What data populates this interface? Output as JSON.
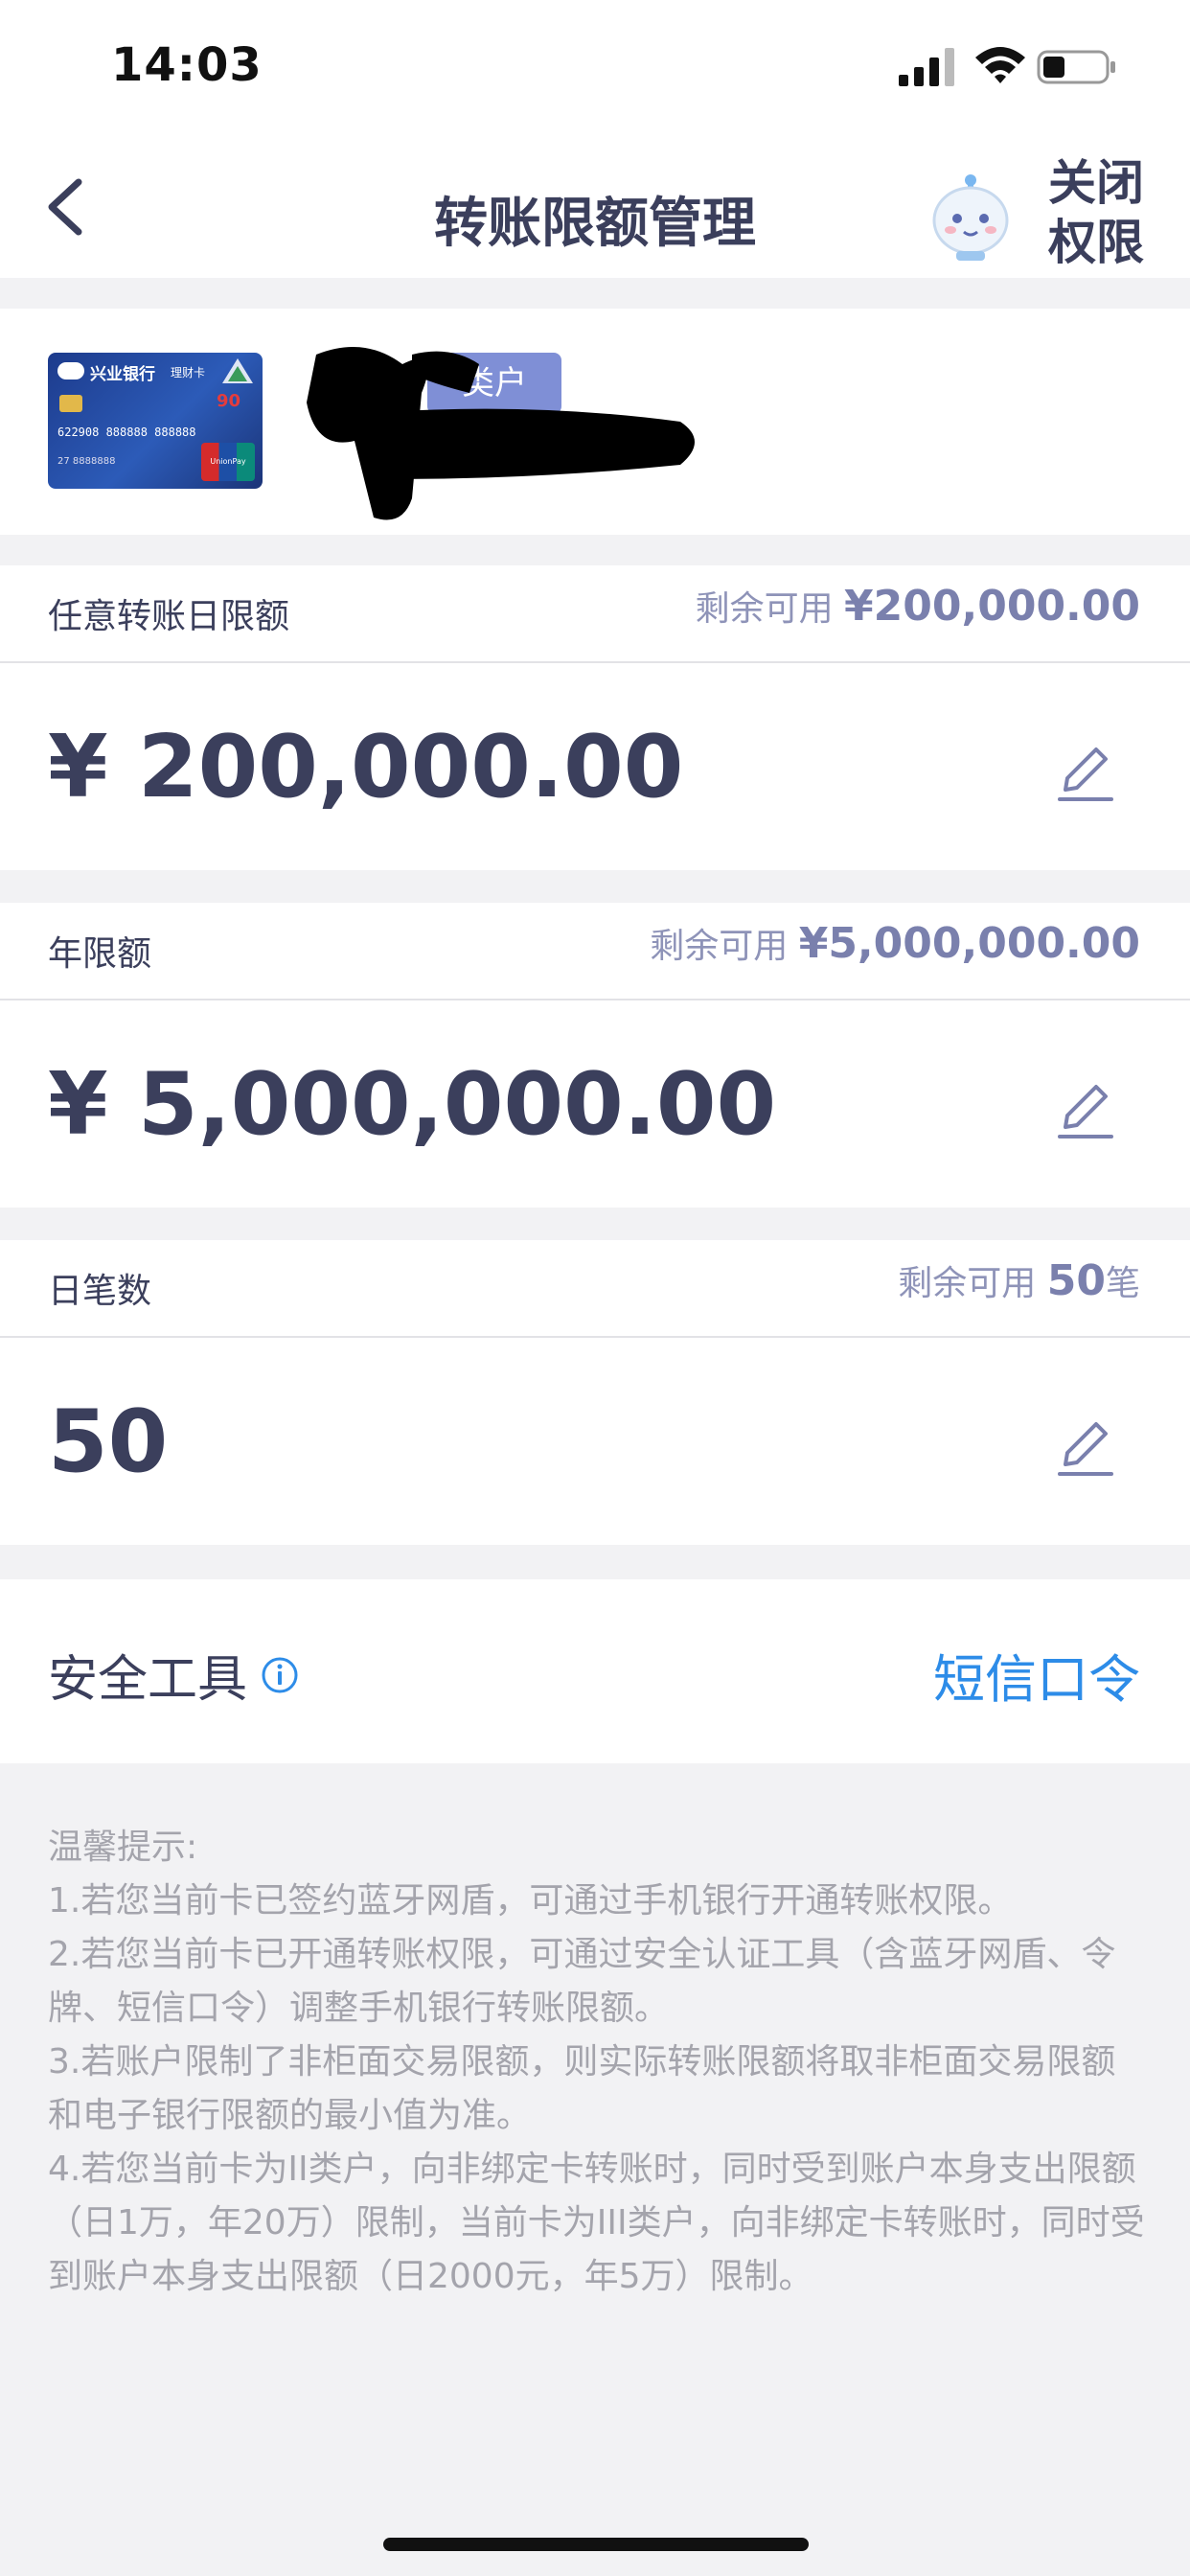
{
  "status_bar": {
    "time": "14:03"
  },
  "nav": {
    "title": "转账限额管理",
    "close_permission_line1": "关闭",
    "close_permission_line2": "权限"
  },
  "card": {
    "bank_name": "兴业银行",
    "card_kind": "理财卡",
    "card_number": "622908 888888 888888",
    "card_holder_number": "27 8888888",
    "union_pay_label": "UnionPay",
    "account_type_badge": "类户"
  },
  "limits": [
    {
      "label": "任意转账日限额",
      "remaining_prefix": "剩余可用",
      "remaining_amount": "¥200,000.00",
      "remaining_suffix": "",
      "value": "¥ 200,000.00"
    },
    {
      "label": "年限额",
      "remaining_prefix": "剩余可用",
      "remaining_amount": "¥5,000,000.00",
      "remaining_suffix": "",
      "value": "¥ 5,000,000.00"
    },
    {
      "label": "日笔数",
      "remaining_prefix": "剩余可用",
      "remaining_amount": "50",
      "remaining_suffix": "笔",
      "value": "50"
    }
  ],
  "security": {
    "label": "安全工具",
    "value": "短信口令"
  },
  "tips": [
    "温馨提示:",
    "1.若您当前卡已签约蓝牙网盾，可通过手机银行开通转账权限。",
    "2.若您当前卡已开通转账权限，可通过安全认证工具（含蓝牙网盾、令牌、短信口令）调整手机银行转账限额。",
    "3.若账户限制了非柜面交易限额，则实际转账限额将取非柜面交易限额和电子银行限额的最小值为准。",
    "4.若您当前卡为II类户，向非绑定卡转账时，同时受到账户本身支出限额（日1万，年20万）限制，当前卡为III类户，向非绑定卡转账时，同时受到账户本身支出限额（日2000元，年5万）限制。"
  ],
  "colors": {
    "accent_blue": "#2d8ce8",
    "text_main": "#3b3f5c",
    "text_muted": "#8e93b8",
    "badge": "#7f8fd6"
  }
}
